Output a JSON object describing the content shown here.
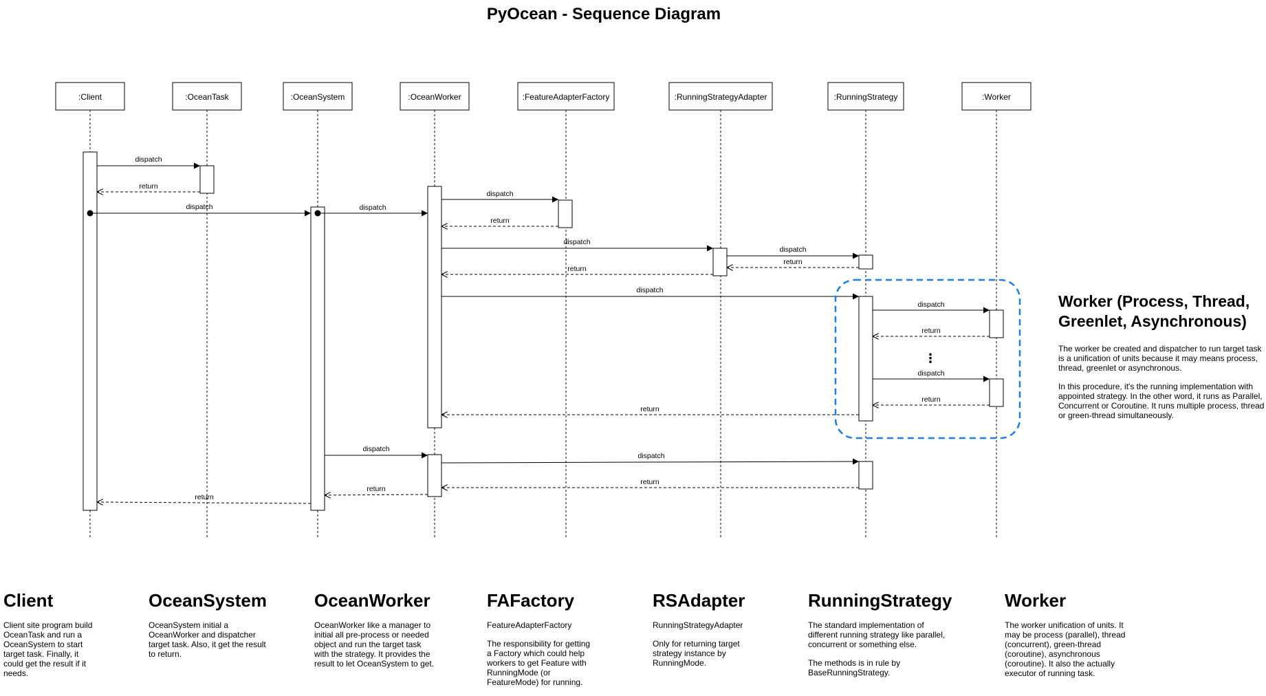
{
  "title": "PyOcean - Sequence Diagram",
  "participants": [
    ":Client",
    ":OceanTask",
    ":OceanSystem",
    ":OceanWorker",
    ":FeatureAdapterFactory",
    ":RunningStrategyAdapter",
    ":RunningStrategy",
    ":Worker"
  ],
  "message_labels": {
    "dispatch": "dispatch",
    "return": "return",
    "ellipsis": "⋮"
  },
  "side_note": {
    "title": "Worker (Process, Thread, Greenlet, Asynchronous)",
    "paragraphs": [
      "The worker be created and dispatcher to run target task is a unification of units because it may means process, thread, greenlet or asynchronous.",
      "In this procedure, it's the running implementation with appointed strategy. In the other word, it runs as Parallel, Concurrent or Coroutine. It runs multiple process, thread or green-thread simultaneously."
    ]
  },
  "descriptions": [
    {
      "title": "Client",
      "paragraphs": [
        "Client site program build OceanTask and run a OceanSystem to start target task. Finally, it could get the result if it needs."
      ]
    },
    {
      "title": "OceanSystem",
      "paragraphs": [
        "OceanSystem initial a OceanWorker and dispatcher target task. Also, it get the result to return."
      ]
    },
    {
      "title": "OceanWorker",
      "paragraphs": [
        "OceanWorker like a manager to initial all pre-process or needed object and run the target task with the strategy. It provides the result to let OceanSystem to get."
      ]
    },
    {
      "title": "FAFactory",
      "paragraphs": [
        "FeatureAdapterFactory",
        "The responsibility for getting a Factory which could help workers to get Feature with RunningMode (or FeatureMode) for running."
      ]
    },
    {
      "title": "RSAdapter",
      "paragraphs": [
        "RunningStrategyAdapter",
        "Only for returning target strategy instance by RunningMode."
      ]
    },
    {
      "title": "RunningStrategy",
      "paragraphs": [
        "The standard implementation of different running strategy like parallel, concurrent or something else.",
        "The methods is in rule by BaseRunningStrategy."
      ]
    },
    {
      "title": "Worker",
      "paragraphs": [
        "The worker unification of units. It may be process (parallel), thread (concurrent), green-thread (coroutine), asynchronous (coroutine). It also the actually executor of running task."
      ]
    }
  ],
  "colors": {
    "line": "#000000",
    "highlight_box": "#1a7de8",
    "background": "#ffffff"
  }
}
